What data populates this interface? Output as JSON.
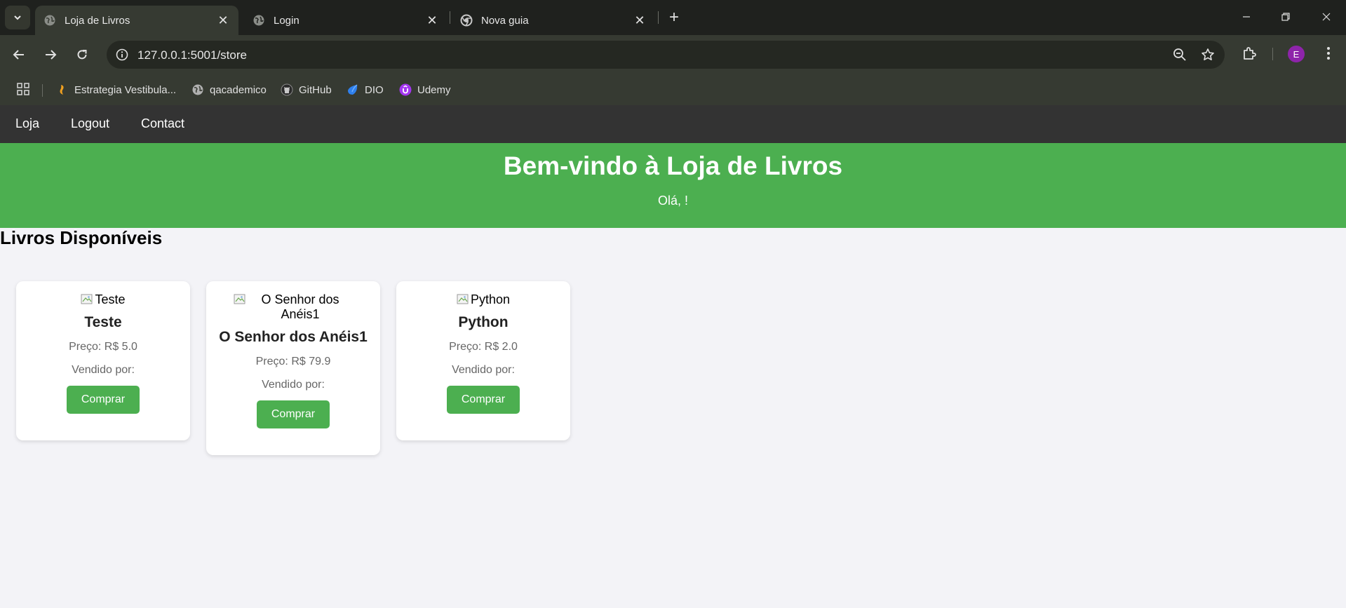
{
  "browser": {
    "tabs": [
      {
        "title": "Loja de Livros",
        "active": true,
        "icon": "globe-icon"
      },
      {
        "title": "Login",
        "active": false,
        "icon": "globe-icon"
      },
      {
        "title": "Nova guia",
        "active": false,
        "icon": "chrome-icon"
      }
    ],
    "url": "127.0.0.1:5001/store",
    "profile_initial": "E",
    "bookmarks": [
      {
        "label": "Estrategia Vestibula...",
        "icon": "estrategia-icon"
      },
      {
        "label": "qacademico",
        "icon": "globe-icon"
      },
      {
        "label": "GitHub",
        "icon": "github-icon"
      },
      {
        "label": "DIO",
        "icon": "dio-icon"
      },
      {
        "label": "Udemy",
        "icon": "udemy-icon"
      }
    ]
  },
  "nav": {
    "items": [
      "Loja",
      "Logout",
      "Contact"
    ]
  },
  "hero": {
    "title": "Bem-vindo à Loja de Livros",
    "greeting": "Olá, !"
  },
  "section_title": "Livros Disponíveis",
  "books": [
    {
      "image_alt": "Teste",
      "title": "Teste",
      "price": "Preço: R$ 5.0",
      "seller": "Vendido por:",
      "button": "Comprar"
    },
    {
      "image_alt": "O Senhor dos Anéis1",
      "title": "O Senhor dos Anéis1",
      "price": "Preço: R$ 79.9",
      "seller": "Vendido por:",
      "button": "Comprar"
    },
    {
      "image_alt": "Python",
      "title": "Python",
      "price": "Preço: R$ 2.0",
      "seller": "Vendido por:",
      "button": "Comprar"
    }
  ],
  "colors": {
    "accent": "#4caf50",
    "nav_bg": "#333333",
    "page_bg": "#f3f3f7"
  }
}
